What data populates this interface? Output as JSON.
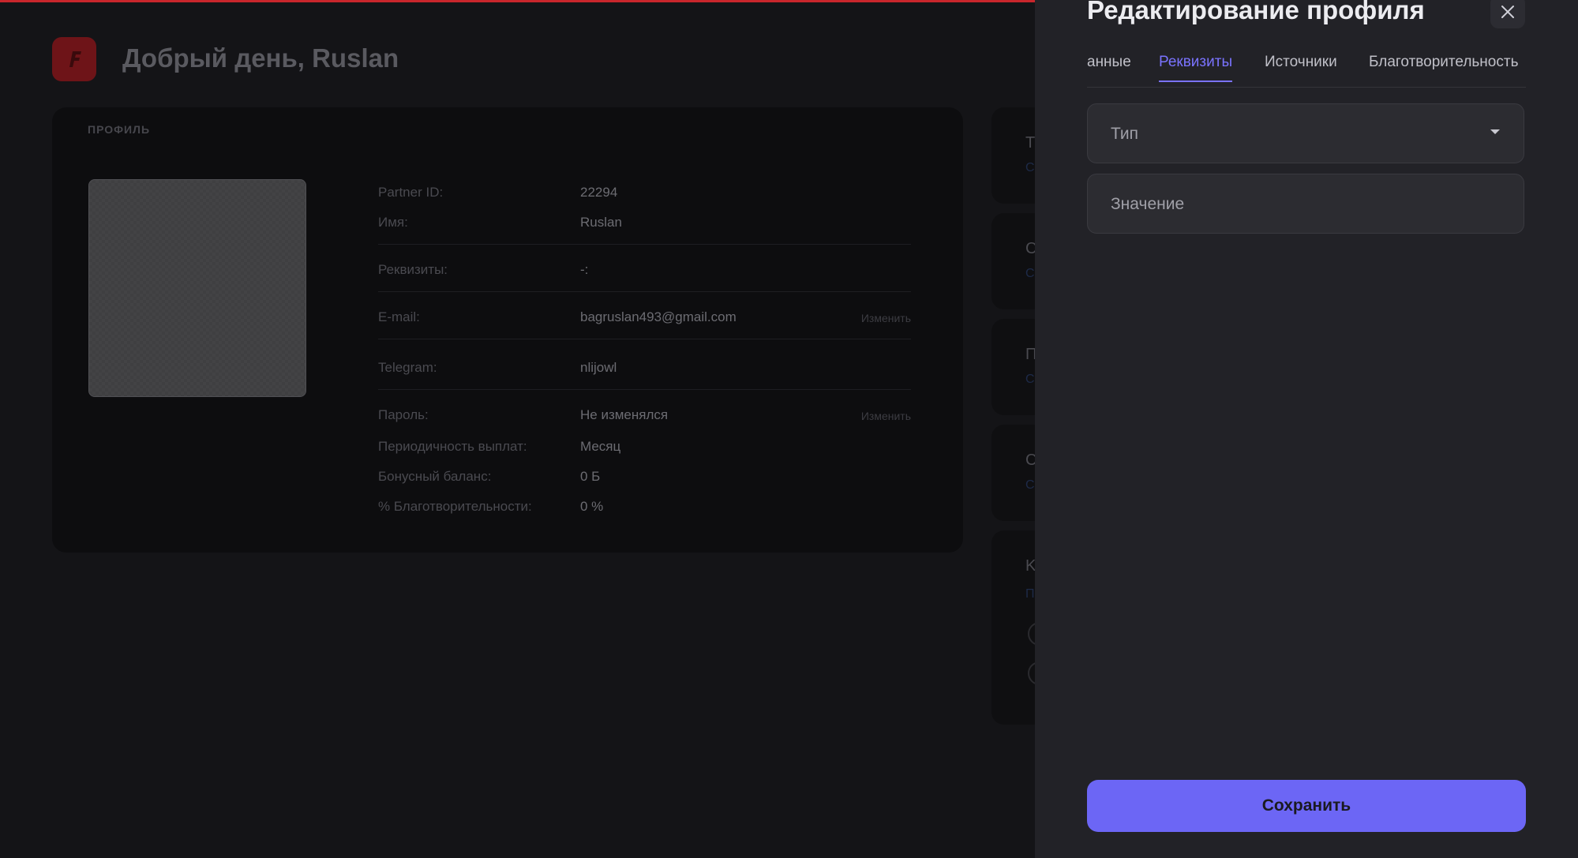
{
  "dashboard": {
    "logo_letter": "F",
    "greeting": "Добрый день, Ruslan",
    "profile": {
      "caption": "ПРОФИЛЬ",
      "fields": {
        "partner_id": {
          "label": "Partner ID:",
          "value": "22294"
        },
        "name": {
          "label": "Имя:",
          "value": "Ruslan"
        },
        "requisites": {
          "label": "Реквизиты:",
          "value": "-:"
        },
        "email": {
          "label": "E-mail:",
          "value": "bagruslan493@gmail.com",
          "action": "Изменить"
        },
        "telegram": {
          "label": "Telegram:",
          "value": "nlijowl"
        },
        "password": {
          "label": "Пароль:",
          "value": "Не изменялся",
          "action": "Изменить"
        },
        "payout_period": {
          "label": "Периодичность выплат:",
          "value": "Месяц"
        },
        "bonus_balance": {
          "label": "Бонусный баланс:",
          "value": "0 Б"
        },
        "charity_percent": {
          "label": "% Благотворительности:",
          "value": "0 %"
        }
      }
    },
    "side_cards": [
      {
        "heading": "T",
        "sub": "C"
      },
      {
        "heading": "C",
        "sub": "C"
      },
      {
        "heading": "П",
        "sub": "C"
      },
      {
        "heading": "C",
        "sub": "C"
      },
      {
        "heading": "K",
        "sub": "П"
      }
    ]
  },
  "drawer": {
    "title": "Редактирование профиля",
    "tabs": [
      {
        "label": "анные"
      },
      {
        "label": "Реквизиты"
      },
      {
        "label": "Источники"
      },
      {
        "label": "Благотворительность"
      }
    ],
    "active_tab": "Реквизиты",
    "type_field": {
      "placeholder": "Тип"
    },
    "value_field": {
      "placeholder": "Значение"
    },
    "save_label": "Сохранить"
  },
  "colors": {
    "accent": "#6c66f5",
    "active_tab": "#7a73ff",
    "top_bar": "#c8262c",
    "logo_bg": "#6e1418"
  }
}
